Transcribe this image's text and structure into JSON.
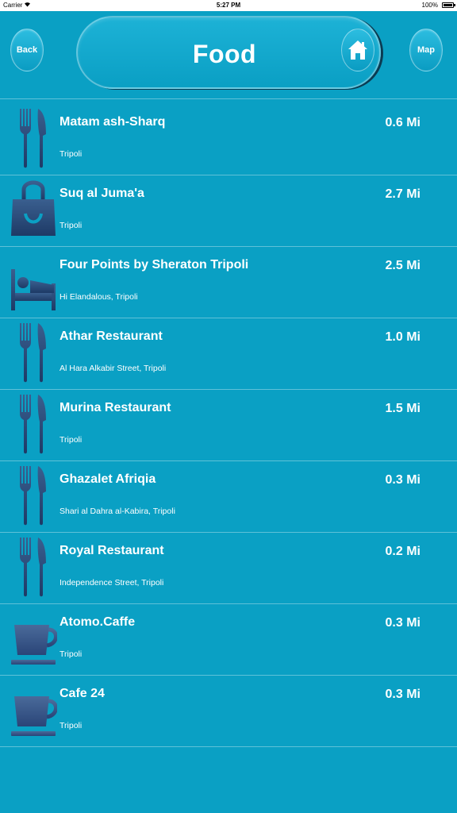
{
  "status_bar": {
    "carrier": "Carrier",
    "time": "5:27 PM",
    "battery": "100%"
  },
  "header": {
    "back_label": "Back",
    "title": "Food",
    "map_label": "Map",
    "home_icon": "home-icon"
  },
  "colors": {
    "background": "#0aa0c4",
    "icon": "#2a4a7c"
  },
  "items": [
    {
      "name": "Matam ash-Sharq",
      "address": "Tripoli",
      "distance": "0.6 Mi",
      "icon": "fork-knife-icon"
    },
    {
      "name": "Suq al Juma'a",
      "address": "Tripoli",
      "distance": "2.7 Mi",
      "icon": "shopping-bag-icon"
    },
    {
      "name": "Four Points by Sheraton Tripoli",
      "address": "Hi Elandalous, Tripoli",
      "distance": "2.5 Mi",
      "icon": "bed-icon"
    },
    {
      "name": "Athar Restaurant",
      "address": "Al Hara Alkabir Street, Tripoli",
      "distance": "1.0 Mi",
      "icon": "fork-knife-icon"
    },
    {
      "name": "Murina Restaurant",
      "address": "Tripoli",
      "distance": "1.5 Mi",
      "icon": "fork-knife-icon"
    },
    {
      "name": "Ghazalet Afriqia",
      "address": "Shari al Dahra al-Kabira, Tripoli",
      "distance": "0.3 Mi",
      "icon": "fork-knife-icon"
    },
    {
      "name": "Royal Restaurant",
      "address": "Independence Street, Tripoli",
      "distance": "0.2 Mi",
      "icon": "fork-knife-icon"
    },
    {
      "name": "Atomo.Caffe",
      "address": "Tripoli",
      "distance": "0.3 Mi",
      "icon": "coffee-cup-icon"
    },
    {
      "name": "Cafe 24",
      "address": "Tripoli",
      "distance": "0.3 Mi",
      "icon": "coffee-cup-icon"
    }
  ]
}
